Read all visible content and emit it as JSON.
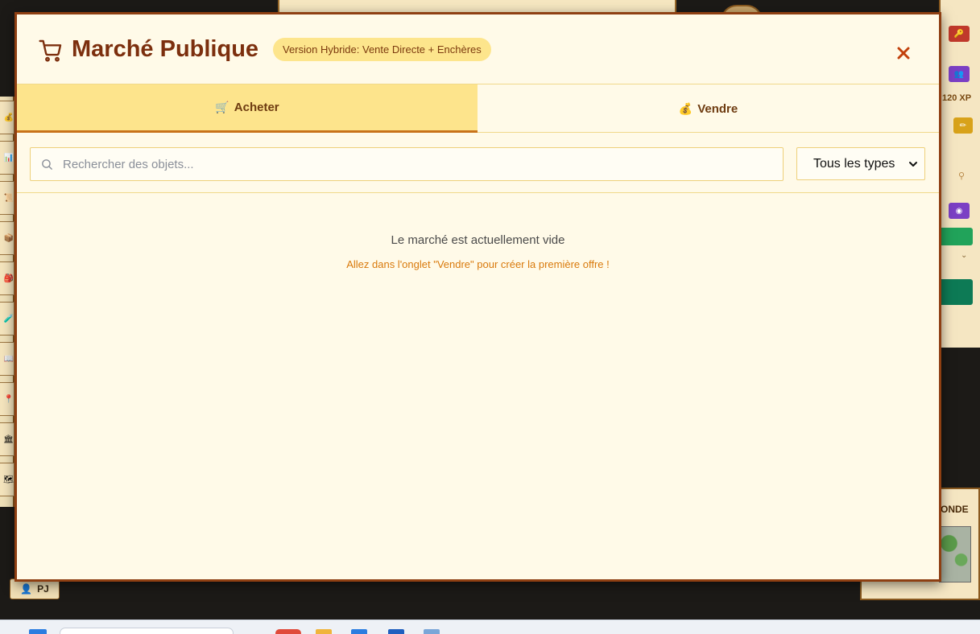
{
  "modal": {
    "title": "Marché Publique",
    "mode_badge": "Version Hybride: Vente Directe + Enchères",
    "close_icon": "close-icon",
    "cart_icon": "shopping-cart-icon"
  },
  "tabs": [
    {
      "label": "Acheter",
      "emoji": "🛒",
      "active": true
    },
    {
      "label": "Vendre",
      "emoji": "💰",
      "active": false
    }
  ],
  "filters": {
    "search_placeholder": "Rechercher des objets...",
    "search_value": "",
    "type_selected": "Tous les types"
  },
  "empty_state": {
    "title": "Le marché est actuellement vide",
    "hint": "Allez dans l'onglet \"Vendre\" pour créer la première offre !"
  },
  "background": {
    "xp_label": "120 XP",
    "minimap_label": "ONDE",
    "player_chip": "PJ"
  },
  "colors": {
    "modal_bg": "#fffae8",
    "accent_border": "#8e3f12",
    "title": "#7c2f0e",
    "tab_active_bg": "#fde48c",
    "hint": "#d97a0c"
  }
}
